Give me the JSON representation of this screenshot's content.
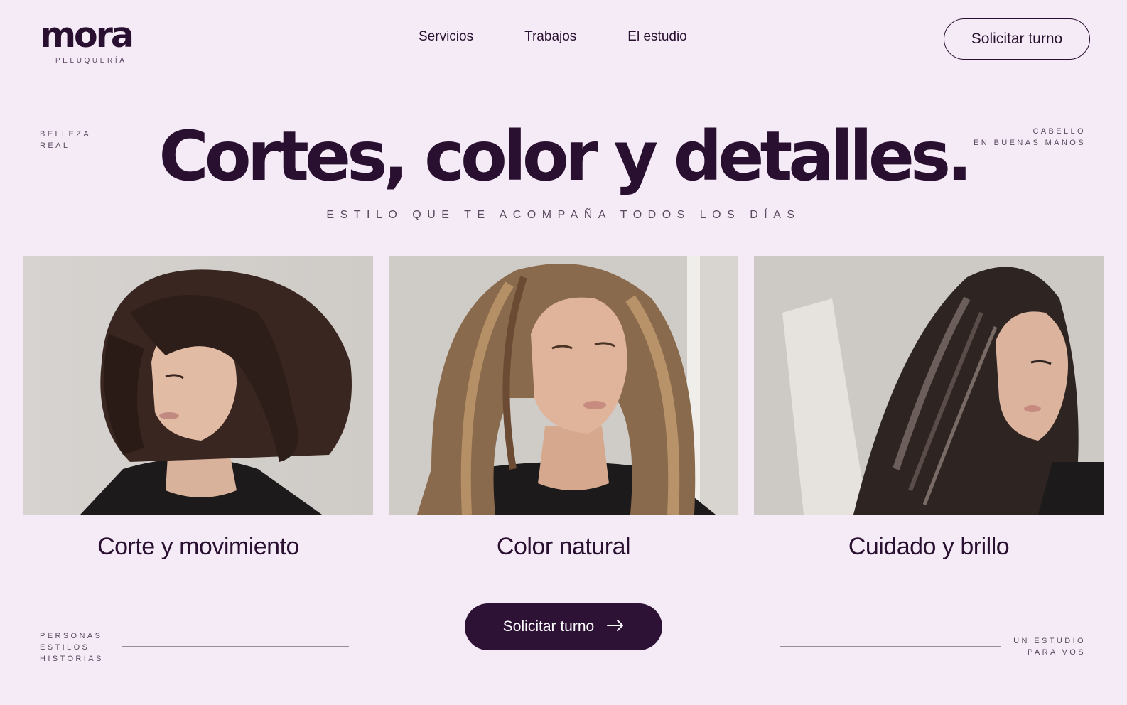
{
  "brand": {
    "name": "mora",
    "tagline": "PELUQUERÍA"
  },
  "nav": {
    "items": [
      "Servicios",
      "Trabajos",
      "El estudio"
    ]
  },
  "header": {
    "cta_label": "Solicitar turno"
  },
  "hero": {
    "title": "Cortes, color y detalles.",
    "subtitle": "ESTILO QUE TE ACOMPAÑA TODOS LOS DÍAS"
  },
  "notes": {
    "top_left": "BELLEZA\nREAL",
    "top_right": "CABELLO\nEN BUENAS MANOS",
    "bottom_left": "PERSONAS\nESTILOS\nHISTORIAS",
    "bottom_right": "UN ESTUDIO\nPARA VOS"
  },
  "cards": [
    {
      "caption": "Corte y movimiento",
      "image": "woman-short-bob-photo"
    },
    {
      "caption": "Color natural",
      "image": "woman-balayage-waves-photo"
    },
    {
      "caption": "Cuidado y brillo",
      "image": "woman-sleek-straight-hair-photo"
    }
  ],
  "cta": {
    "label": "Solicitar turno",
    "icon": "arrow-right-icon"
  },
  "colors": {
    "background": "#f5ebf7",
    "primary": "#2a1030",
    "button": "#2d1236"
  }
}
